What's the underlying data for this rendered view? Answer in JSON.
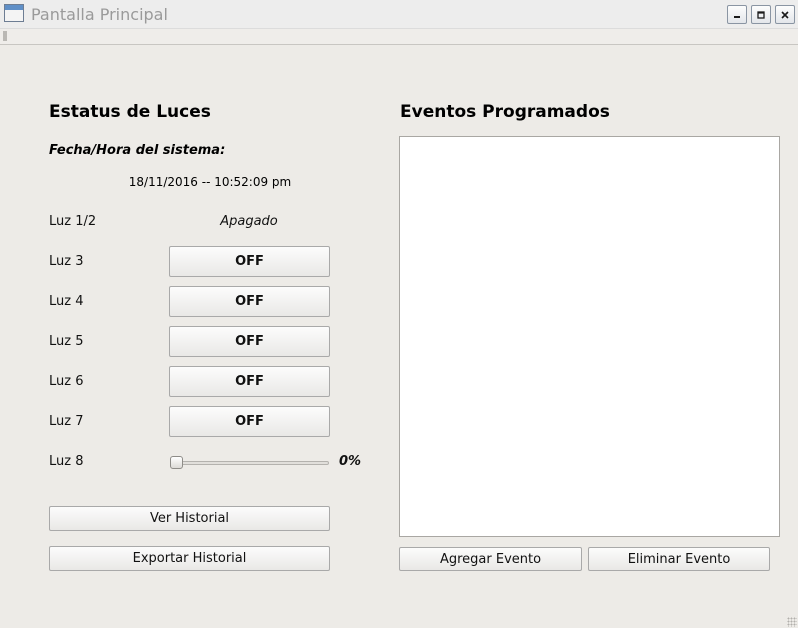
{
  "window": {
    "title": "Pantalla Principal"
  },
  "lights_panel": {
    "title": "Estatus de Luces",
    "datetime_label": "Fecha/Hora del sistema:",
    "datetime_value": "18/11/2016 -- 10:52:09 pm",
    "lights": [
      {
        "label": "Luz 1/2",
        "state": "Apagado"
      },
      {
        "label": "Luz 3",
        "button": "OFF"
      },
      {
        "label": "Luz 4",
        "button": "OFF"
      },
      {
        "label": "Luz 5",
        "button": "OFF"
      },
      {
        "label": "Luz 6",
        "button": "OFF"
      },
      {
        "label": "Luz 7",
        "button": "OFF"
      }
    ],
    "dimmer": {
      "label": "Luz 8",
      "value": 0,
      "value_text": "0%"
    },
    "history_button": "Ver Historial",
    "export_button": "Exportar Historial"
  },
  "events_panel": {
    "title": "Eventos Programados",
    "items": [],
    "add_button": "Agregar Evento",
    "remove_button": "Eliminar Evento"
  },
  "icons": {
    "app": "window-app-icon",
    "minimize": "minimize-icon",
    "maximize": "maximize-icon",
    "close": "close-icon"
  }
}
